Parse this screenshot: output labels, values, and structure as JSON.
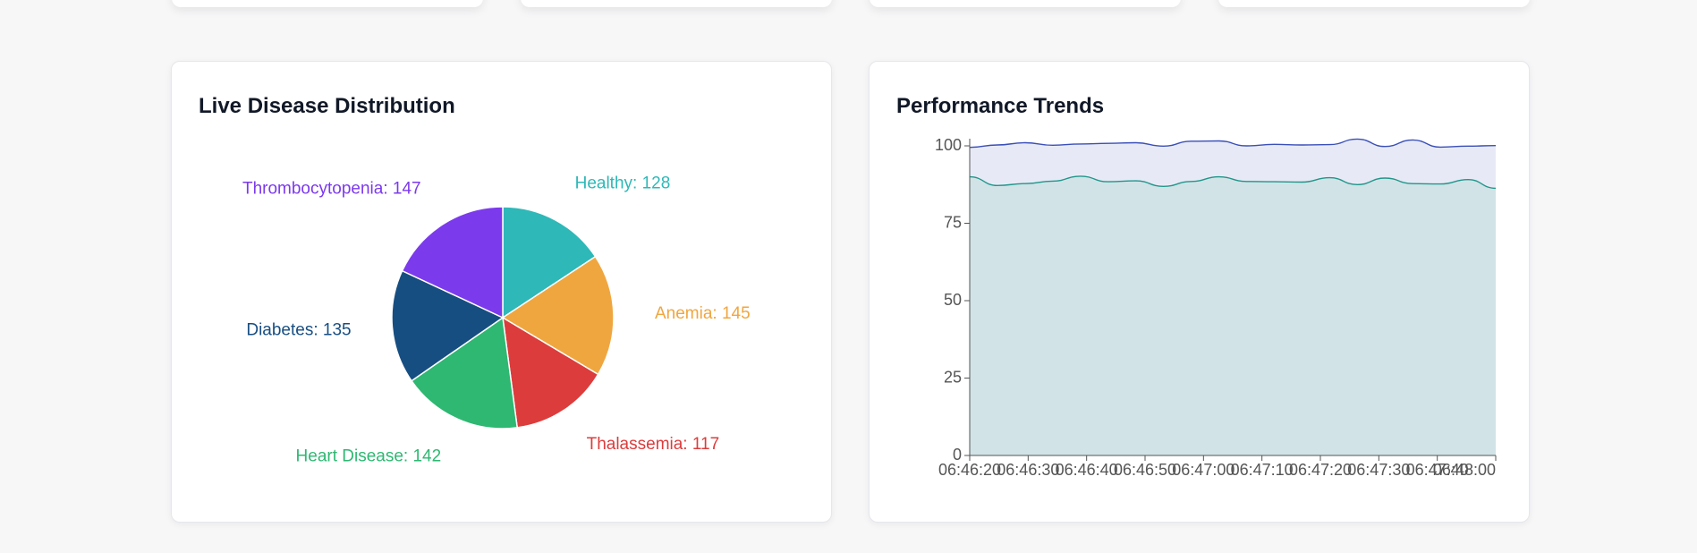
{
  "cards": {
    "pie": {
      "title": "Live Disease Distribution"
    },
    "perf": {
      "title": "Performance Trends"
    }
  },
  "chart_data": [
    {
      "type": "pie",
      "title": "Live Disease Distribution",
      "slices": [
        {
          "label": "Healthy",
          "value": 128,
          "color": "#2eb8b8"
        },
        {
          "label": "Anemia",
          "value": 145,
          "color": "#f0a63f"
        },
        {
          "label": "Thalassemia",
          "value": 117,
          "color": "#dc3c3c"
        },
        {
          "label": "Heart Disease",
          "value": 142,
          "color": "#2eb872"
        },
        {
          "label": "Diabetes",
          "value": 135,
          "color": "#174e82"
        },
        {
          "label": "Thrombocytopenia",
          "value": 147,
          "color": "#7c3aed"
        }
      ],
      "legend": "labels-on-slices"
    },
    {
      "type": "area",
      "title": "Performance Trends",
      "xlabel": "",
      "ylabel": "",
      "ylim": [
        0,
        100
      ],
      "yticks": [
        0,
        25,
        50,
        75,
        100
      ],
      "xticks": [
        "06:46:20",
        "06:46:30",
        "06:46:40",
        "06:46:50",
        "06:47:00",
        "06:47:10",
        "06:47:20",
        "06:47:30",
        "06:47:40",
        "06:48:00"
      ],
      "x": [
        "06:46:20",
        "06:46:25",
        "06:46:30",
        "06:46:35",
        "06:46:40",
        "06:46:45",
        "06:46:50",
        "06:46:55",
        "06:47:00",
        "06:47:05",
        "06:47:10",
        "06:47:15",
        "06:47:20",
        "06:47:25",
        "06:47:30",
        "06:47:35",
        "06:47:40",
        "06:47:45",
        "06:47:50",
        "06:48:00"
      ],
      "series": [
        {
          "color": "#3a4fb8",
          "fill": "#e7eaf6",
          "values": [
            99.5,
            100.3,
            101,
            100.2,
            100.6,
            100.8,
            101,
            99.9,
            101.5,
            101.6,
            100,
            100.5,
            100.3,
            100.4,
            102.2,
            99.8,
            101.9,
            99.6,
            99.9,
            100.1
          ]
        },
        {
          "color": "#21968a",
          "fill": "#d1e3e7",
          "values": [
            90,
            87.2,
            87.8,
            88.6,
            90.2,
            88.4,
            88.7,
            86.9,
            88.5,
            90,
            88.5,
            88.4,
            88.3,
            89.7,
            87.5,
            89.6,
            87.8,
            87.7,
            89.1,
            86.3
          ]
        }
      ],
      "grid": false
    }
  ]
}
